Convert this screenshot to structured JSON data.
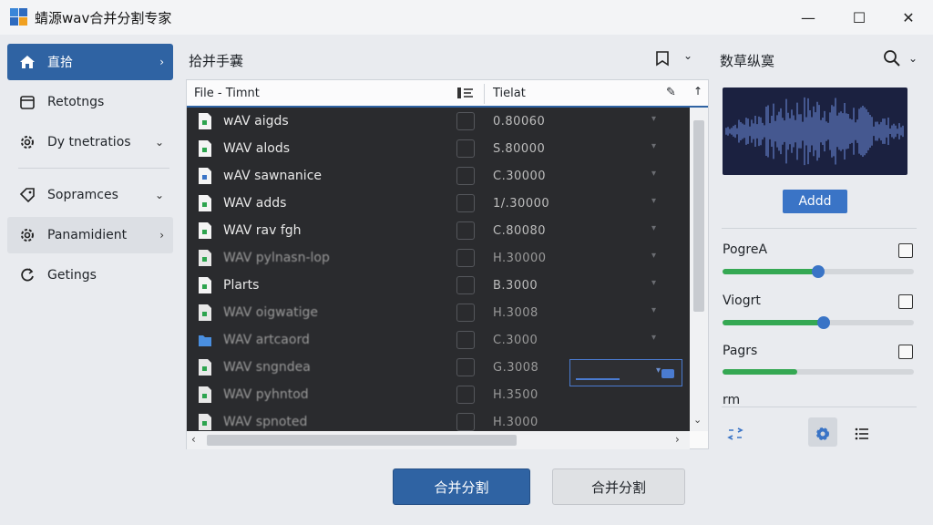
{
  "window": {
    "title": "蜻源wav合并分割专家",
    "min_glyph": "—",
    "max_glyph": "☐",
    "close_glyph": "✕"
  },
  "sidebar": {
    "items": [
      {
        "label": "直拾",
        "icon": "home-icon",
        "chevron": "›",
        "active": true
      },
      {
        "label": "Retotngs",
        "icon": "calendar-icon",
        "chevron": ""
      },
      {
        "label": "Dy tnetratios",
        "icon": "gear-icon",
        "chevron": "⌄"
      },
      {
        "label": "Sopramces",
        "icon": "tag-icon",
        "chevron": "⌄"
      },
      {
        "label": "Panamidient",
        "icon": "gear-icon",
        "chevron": "›"
      },
      {
        "label": "Getings",
        "icon": "refresh-gear-icon",
        "chevron": ""
      }
    ]
  },
  "middle": {
    "title": "拾并手嚢",
    "chevron": "⌄",
    "columns": {
      "file": "File - Timnt",
      "time": "Tielat",
      "edit_glyph": "✎",
      "sort_glyph": "↑"
    },
    "rows": [
      {
        "name": "wAV aigds",
        "time": "0.80060",
        "icon": "wav-file-icon",
        "faded": false
      },
      {
        "name": "WAV alods",
        "time": "S.80000",
        "icon": "wav-file-icon",
        "faded": false
      },
      {
        "name": "wAV sawnanice",
        "time": "C.30000",
        "icon": "wav-file-icon",
        "faded": false
      },
      {
        "name": "WAV adds",
        "time": "1/.30000",
        "icon": "wav-file-icon",
        "faded": false
      },
      {
        "name": "WAV rav fgh",
        "time": "C.80080",
        "icon": "wav-file-icon",
        "faded": false
      },
      {
        "name": "WAV pylnasn-lop",
        "time": "H.30000",
        "icon": "wav-file-icon",
        "faded": true
      },
      {
        "name": "Plarts",
        "time": "B.3000",
        "icon": "wav-file-icon",
        "faded": false
      },
      {
        "name": "WAV oigwatige",
        "time": "H.3008",
        "icon": "wav-file-icon",
        "faded": true
      },
      {
        "name": "WAV artcaord",
        "time": "C.3000",
        "icon": "folder-icon",
        "faded": true
      },
      {
        "name": "WAV sngndea",
        "time": "G.3008",
        "icon": "wav-file-icon",
        "faded": true
      },
      {
        "name": "WAV pyhntod",
        "time": "H.3500",
        "icon": "wav-file-icon",
        "faded": true
      },
      {
        "name": "WAV spnoted",
        "time": "H.3000",
        "icon": "wav-file-icon",
        "faded": true
      }
    ],
    "dropdown_glyph": "▾",
    "scroll": {
      "up": "↑",
      "down": "⌄",
      "left": "‹",
      "right": "›"
    }
  },
  "actions": {
    "primary_label": "合并分割",
    "secondary_label": "合并分割"
  },
  "right": {
    "title": "数草纵寞",
    "chevron": "⌄",
    "add_label": "Addd",
    "params": [
      {
        "label": "PogreA",
        "value": 0.5
      },
      {
        "label": "Viogrt",
        "value": 0.53
      },
      {
        "label": "Pagrs",
        "value": 0.39
      },
      {
        "label": "rm",
        "value": null
      }
    ]
  },
  "colors": {
    "accent": "#2f63a3",
    "slider_fill": "#35a853",
    "list_bg": "#2a2b2e"
  }
}
